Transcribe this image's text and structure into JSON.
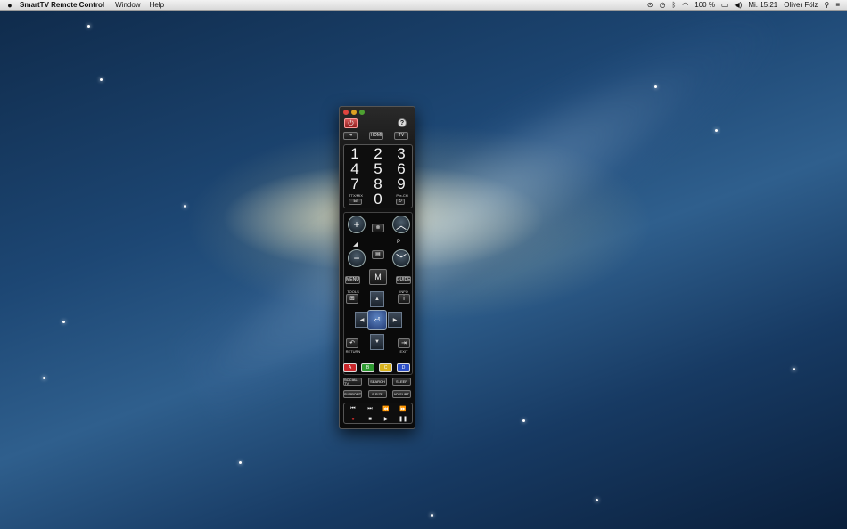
{
  "menubar": {
    "apple_icon": "apple-icon",
    "app_name": "SmartTV Remote Control",
    "menus": [
      "Window",
      "Help"
    ],
    "battery": "100 %",
    "clock": "Mi. 15:21",
    "user": "Oliver Fölz"
  },
  "remote": {
    "help_label": "?",
    "sources": [
      "",
      "HDMI",
      "TV"
    ],
    "numbers": [
      "1",
      "2",
      "3",
      "4",
      "5",
      "6",
      "7",
      "8",
      "9",
      "0"
    ],
    "ttx_label": "TTX/MIX",
    "prech_label": "Pre-CH",
    "p_label": "P",
    "menu_label": "MENU",
    "guide_label": "GUIDE",
    "tools_label": "TOOLS",
    "info_label": "INFO",
    "return_label": "RETURN",
    "exit_label": "EXIT",
    "colors": [
      {
        "label": "A",
        "color": "#c8262a"
      },
      {
        "label": "B",
        "color": "#2e9a31"
      },
      {
        "label": "C",
        "color": "#d8b21e"
      },
      {
        "label": "D",
        "color": "#2d4fc6"
      }
    ],
    "row1": [
      "SOCIAL TV",
      "SEARCH",
      "SLEEP"
    ],
    "row2": [
      "SUPPORT",
      "P.SIZE",
      "AD/SUBT."
    ]
  }
}
